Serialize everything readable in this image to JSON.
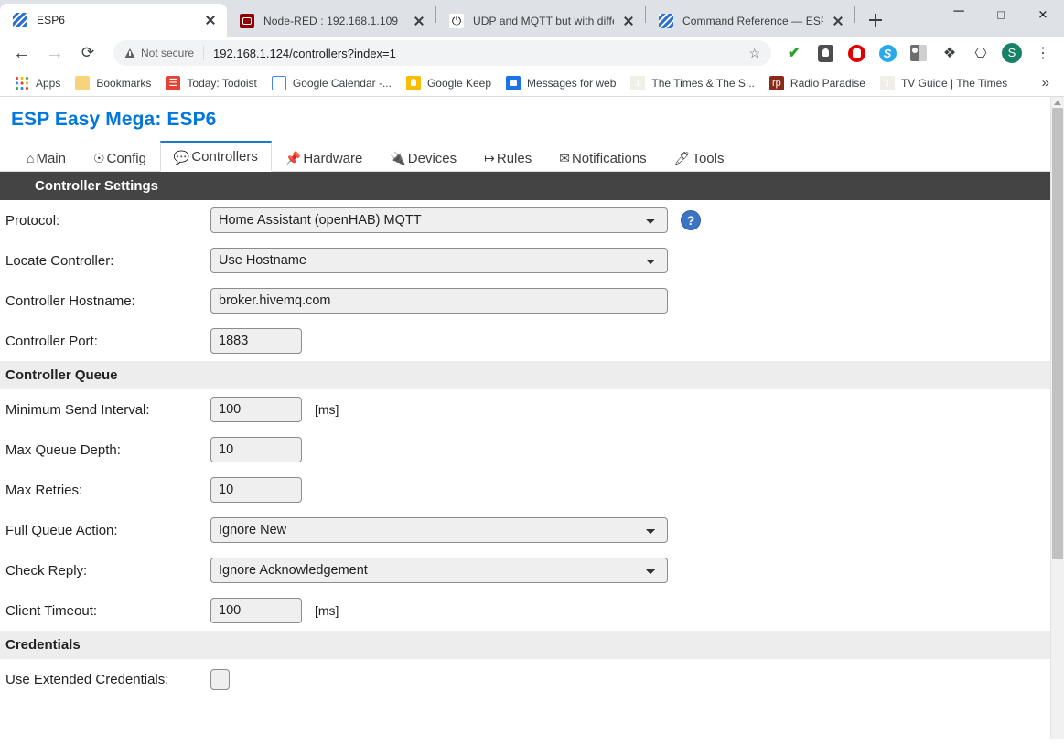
{
  "browser": {
    "tabs": [
      {
        "title": "ESP6",
        "favicon": "esp-easy-icon",
        "active": true
      },
      {
        "title": "Node-RED : 192.168.1.109",
        "favicon": "node-red-icon",
        "active": false
      },
      {
        "title": "UDP and MQTT but with differen",
        "favicon": "power-icon",
        "active": false
      },
      {
        "title": "Command Reference — ESP Eas",
        "favicon": "esp-easy-icon",
        "active": false
      }
    ],
    "new_tab_label": "+",
    "window_controls": {
      "minimize": "─",
      "maximize": "□",
      "close": "✕"
    },
    "nav": {
      "back": "←",
      "forward": "→",
      "reload": "⟳"
    },
    "omnibox": {
      "security_label": "Not secure",
      "url": "192.168.1.124/controllers?index=1",
      "star": "☆"
    },
    "toolbar_icons": [
      {
        "name": "checkmark-icon",
        "glyph": "✔"
      },
      {
        "name": "lightbulb-icon",
        "glyph": ""
      },
      {
        "name": "adblock-icon",
        "glyph": ""
      },
      {
        "name": "skype-icon",
        "glyph": "S"
      },
      {
        "name": "person-image-icon",
        "glyph": ""
      },
      {
        "name": "extensions-puzzle-icon",
        "glyph": "❖"
      },
      {
        "name": "cast-icon",
        "glyph": "⎔"
      },
      {
        "name": "profile-avatar",
        "glyph": "S"
      },
      {
        "name": "chrome-menu-icon",
        "glyph": "⋮"
      }
    ],
    "bookmarks": [
      {
        "label": "Apps",
        "icon": "apps-grid-icon"
      },
      {
        "label": "Bookmarks",
        "icon": "folder-icon"
      },
      {
        "label": "Today: Todoist",
        "icon": "todoist-icon"
      },
      {
        "label": "Google Calendar -...",
        "icon": "google-calendar-icon"
      },
      {
        "label": "Google Keep",
        "icon": "google-keep-icon"
      },
      {
        "label": "Messages for web",
        "icon": "messages-icon"
      },
      {
        "label": "The Times & The S...",
        "icon": "the-times-icon"
      },
      {
        "label": "Radio Paradise",
        "icon": "radio-paradise-icon"
      },
      {
        "label": "TV Guide | The Times",
        "icon": "the-times-icon"
      }
    ],
    "bookmarks_overflow": "»"
  },
  "page": {
    "title": "ESP Easy Mega: ESP6",
    "nav_tabs": [
      {
        "label": "Main",
        "icon": "⌂",
        "active": false
      },
      {
        "label": "Config",
        "icon": "☉",
        "active": false
      },
      {
        "label": "Controllers",
        "icon": "💬",
        "active": true
      },
      {
        "label": "Hardware",
        "icon": "📌",
        "active": false
      },
      {
        "label": "Devices",
        "icon": "🔌",
        "active": false
      },
      {
        "label": "Rules",
        "icon": "↦",
        "active": false
      },
      {
        "label": "Notifications",
        "icon": "✉",
        "active": false
      },
      {
        "label": "Tools",
        "icon": "🖊",
        "active": false
      }
    ],
    "sections": {
      "controller_settings": {
        "heading": "Controller Settings",
        "protocol": {
          "label": "Protocol:",
          "value": "Home Assistant (openHAB) MQTT",
          "help": "?"
        },
        "locate_controller": {
          "label": "Locate Controller:",
          "value": "Use Hostname"
        },
        "controller_hostname": {
          "label": "Controller Hostname:",
          "value": "broker.hivemq.com"
        },
        "controller_port": {
          "label": "Controller Port:",
          "value": "1883"
        }
      },
      "controller_queue": {
        "heading": "Controller Queue",
        "minimum_send_interval": {
          "label": "Minimum Send Interval:",
          "value": "100",
          "unit": "[ms]"
        },
        "max_queue_depth": {
          "label": "Max Queue Depth:",
          "value": "10"
        },
        "max_retries": {
          "label": "Max Retries:",
          "value": "10"
        },
        "full_queue_action": {
          "label": "Full Queue Action:",
          "value": "Ignore New"
        },
        "check_reply": {
          "label": "Check Reply:",
          "value": "Ignore Acknowledgement"
        },
        "client_timeout": {
          "label": "Client Timeout:",
          "value": "100",
          "unit": "[ms]"
        }
      },
      "credentials": {
        "heading": "Credentials",
        "use_extended_credentials": {
          "label": "Use Extended Credentials:",
          "checked": false
        }
      }
    }
  },
  "colors": {
    "page_title": "#0077dd",
    "section_dark_bg": "#444444",
    "section_light_bg": "#ededed",
    "active_tab_border": "#1f78d1",
    "help_icon_bg": "#3b74c4"
  }
}
